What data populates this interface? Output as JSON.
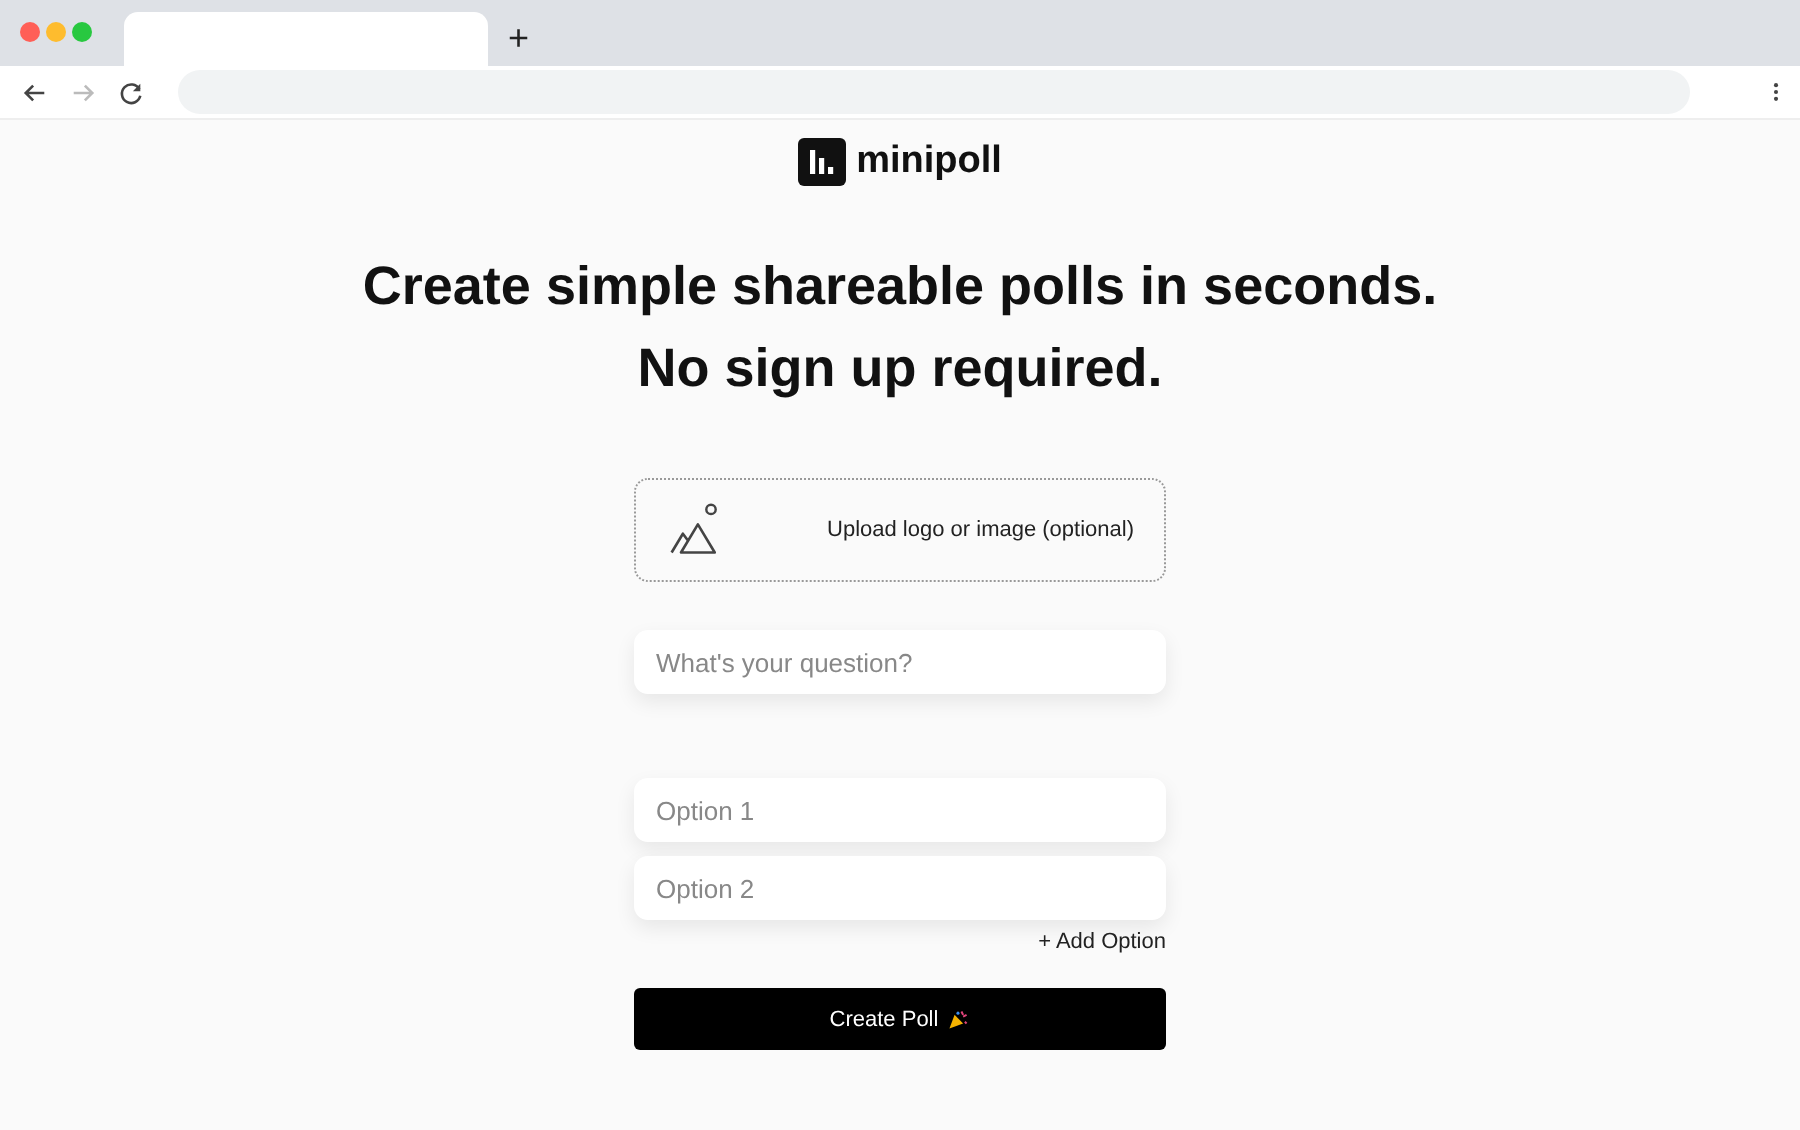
{
  "browser": {
    "new_tab": "+"
  },
  "brand": {
    "name": "minipoll"
  },
  "headline": [
    "Create simple shareable polls in seconds.",
    "No sign up required."
  ],
  "upload": {
    "label": "Upload logo or image (optional)"
  },
  "question": {
    "placeholder": "What's your question?"
  },
  "options": [
    {
      "placeholder": "Option 1"
    },
    {
      "placeholder": "Option 2"
    }
  ],
  "add_option": "+ Add Option",
  "submit": "Create Poll"
}
